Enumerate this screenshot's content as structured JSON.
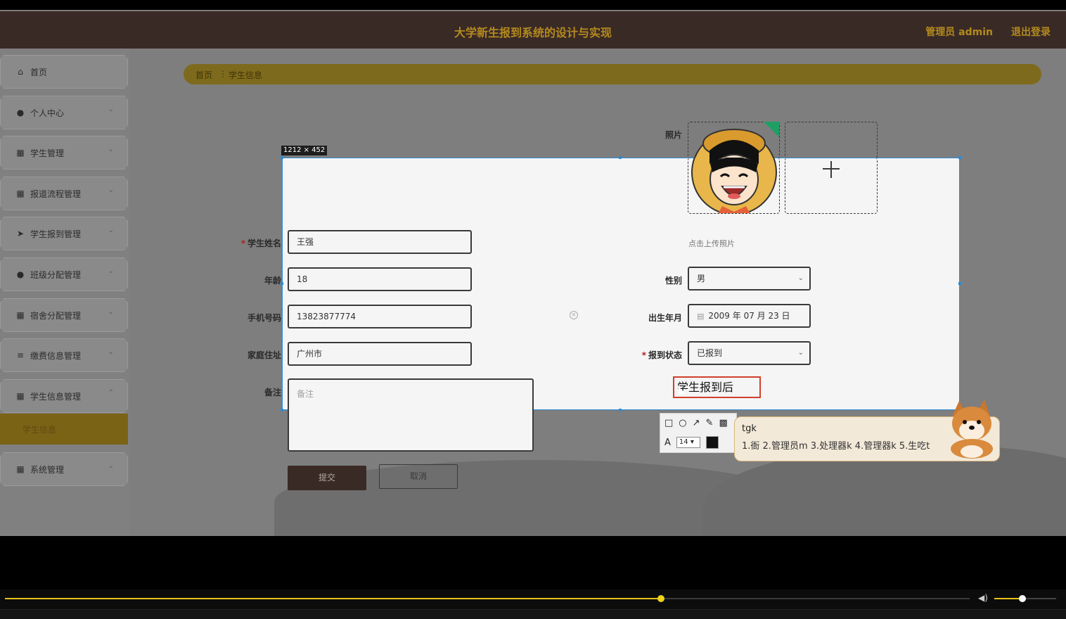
{
  "app": {
    "title": "大学新生报到系统的设计与实现",
    "admin_label": "管理员 admin",
    "logout_label": "退出登录"
  },
  "sidebar": {
    "items": [
      {
        "label": "首页",
        "icon": "home-icon"
      },
      {
        "label": "个人中心",
        "icon": "user-icon"
      },
      {
        "label": "学生管理",
        "icon": "grid-icon"
      },
      {
        "label": "报道流程管理",
        "icon": "grid-icon"
      },
      {
        "label": "学生报到管理",
        "icon": "send-icon"
      },
      {
        "label": "班级分配管理",
        "icon": "pin-icon"
      },
      {
        "label": "宿舍分配管理",
        "icon": "grid-icon"
      },
      {
        "label": "缴费信息管理",
        "icon": "list-icon"
      },
      {
        "label": "学生信息管理",
        "icon": "grid-icon"
      },
      {
        "label": "系统管理",
        "icon": "grid-icon"
      }
    ],
    "active_sub_item": "学生信息"
  },
  "breadcrumb": {
    "home": "首页",
    "current": "学生信息"
  },
  "form": {
    "photo_label": "照片",
    "upload_hint": "点击上传照片",
    "name_label": "学生姓名",
    "name_value": "王强",
    "age_label": "年龄",
    "age_value": "18",
    "phone_label": "手机号码",
    "phone_value": "13823877774",
    "address_label": "家庭住址",
    "address_value": "广州市",
    "remark_label": "备注",
    "remark_placeholder": "备注",
    "gender_label": "性别",
    "gender_value": "男",
    "birth_label": "出生年月",
    "birth_value": "2009 年 07 月 23 日",
    "status_label": "报到状态",
    "status_value": "已报到",
    "submit_label": "提交",
    "cancel_label": "取消"
  },
  "screenshot_tool": {
    "dimensions": "1212 × 452",
    "annotation_text": "学生报到后",
    "font_size": "14"
  },
  "ime": {
    "input": "tgk",
    "candidates": "1.衙 2.管理员m 3.处理器k 4.管理器k 5.生吃t"
  },
  "player": {
    "progress": 0.68,
    "volume": 0.45
  },
  "colors": {
    "accent": "#e8c31a",
    "header_bg": "#3a2a26",
    "title_gold": "#b38a1d",
    "selection_blue": "#2a8cd6",
    "annotation_red": "#d0402a"
  }
}
